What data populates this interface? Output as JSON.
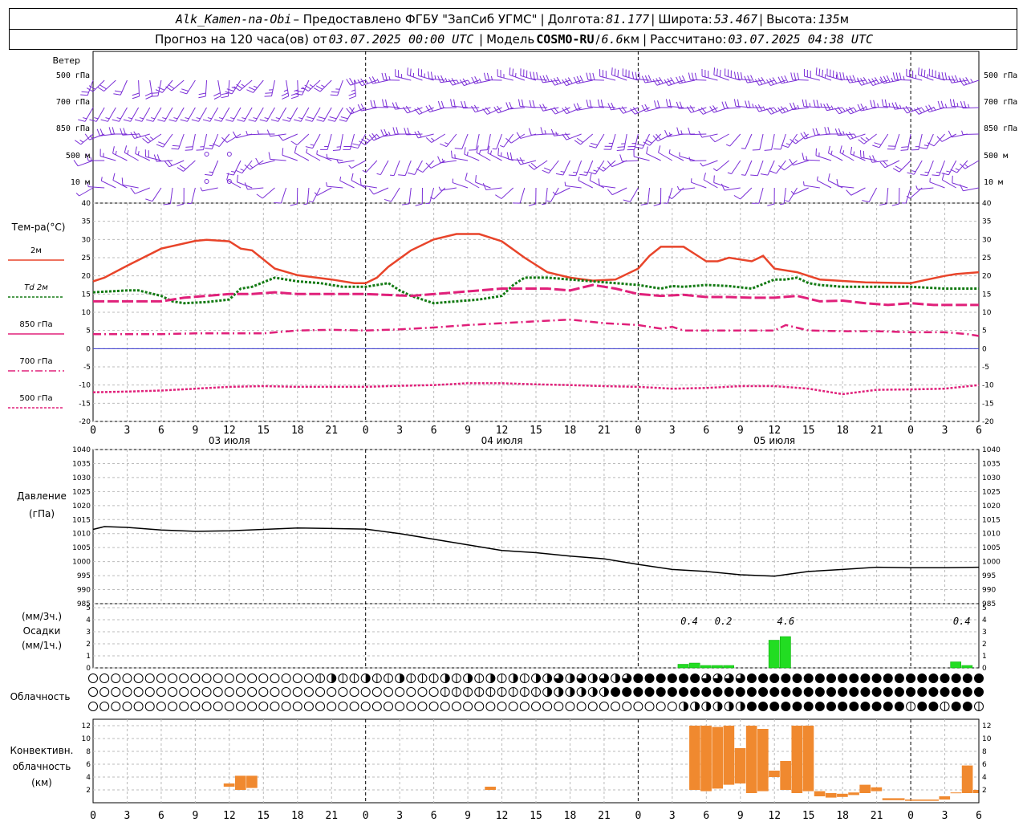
{
  "header": {
    "station": "Alk_Kamen-na-Obi",
    "provider": "– Предоставлено ФГБУ \"ЗапСиб УГМС\"",
    "lon_label": "Долгота:",
    "lon": "81.177",
    "lat_label": "Широта:",
    "lat": "53.467",
    "alt_label": "Высота:",
    "alt": "135",
    "alt_unit": "м",
    "forecast_label": "Прогноз на 120 часа(ов) от",
    "forecast_start": "03.07.2025 00:00 UTC",
    "model_label": "Модель",
    "model": "COSMO-RU",
    "resolution": "6.6",
    "resolution_unit": "км",
    "calc_label": "Рассчитано:",
    "calc_time": "03.07.2025 04:38 UTC"
  },
  "colors": {
    "t2m": "#e8442a",
    "td2m": "#137a13",
    "t850": "#e0207a",
    "t700": "#e0207a",
    "t500": "#e0207a",
    "wind": "#7a2ed6",
    "precip": "#22dd22",
    "conv": "#f0892f",
    "zero_line": "#3333cc"
  },
  "time_axis": {
    "hour_labels": [
      "0",
      "3",
      "6",
      "9",
      "12",
      "15",
      "18",
      "21",
      "0",
      "3",
      "6",
      "9",
      "12",
      "15",
      "18",
      "21",
      "0",
      "3",
      "6",
      "9",
      "12",
      "15",
      "18",
      "21",
      "0",
      "3",
      "6"
    ],
    "date_labels": [
      "03 июля",
      "04 июля",
      "05 июля"
    ]
  },
  "wind_panel": {
    "title": "Ветер",
    "levels": [
      "500 гПа",
      "700 гПа",
      "850 гПа",
      "500 м",
      "10 м"
    ]
  },
  "temp_panel": {
    "title": "Тем-ра(°C)",
    "legend": [
      "2м",
      "Td  2м",
      "850 гПа",
      "700 гПа",
      "500 гПа"
    ],
    "ticks": [
      "40",
      "35",
      "30",
      "25",
      "20",
      "15",
      "10",
      "5",
      "0",
      "-5",
      "-10",
      "-15",
      "-20"
    ]
  },
  "pressure_panel": {
    "title": "Давление",
    "unit": "(гПа)",
    "ticks": [
      "1040",
      "1035",
      "1030",
      "1025",
      "1020",
      "1015",
      "1010",
      "1005",
      "1000",
      "995",
      "990",
      "985"
    ]
  },
  "precip_panel": {
    "unit3h": "(мм/3ч.)",
    "title": "Осадки",
    "unit1h": "(мм/1ч.)",
    "ticks": [
      "5",
      "4",
      "3",
      "2",
      "1",
      "0"
    ],
    "totals": [
      "0.4",
      "0.2",
      "4.6",
      "0.4"
    ]
  },
  "cloud_panel": {
    "title": "Облачность"
  },
  "conv_panel": {
    "title": [
      "Конвективн.",
      "облачность",
      "(км)"
    ],
    "ticks": [
      "12",
      "10",
      "8",
      "6",
      "4",
      "2"
    ]
  },
  "chart_data": {
    "type": "line",
    "x_unit": "hours since 03.07.2025 00:00 UTC",
    "x_range": [
      0,
      78
    ],
    "temperature": {
      "ylim": [
        -20,
        40
      ],
      "series": [
        {
          "name": "2м",
          "x": [
            0,
            1,
            3,
            6,
            9,
            10,
            12,
            13,
            14,
            16,
            18,
            21,
            23,
            24,
            25,
            26,
            28,
            30,
            32,
            34,
            36,
            38,
            40,
            42,
            44,
            46,
            48,
            49,
            50,
            52,
            53,
            54,
            55,
            56,
            57,
            58,
            59,
            60,
            61,
            62,
            64,
            68,
            72,
            75,
            76,
            78
          ],
          "y": [
            18.5,
            19.5,
            22.8,
            27.5,
            29.6,
            29.9,
            29.5,
            27.5,
            27.0,
            22.0,
            20.2,
            19.0,
            18.0,
            18.0,
            19.5,
            22.5,
            27.0,
            30.0,
            31.5,
            31.5,
            29.5,
            25.0,
            21.0,
            19.5,
            18.7,
            19.0,
            22.0,
            25.5,
            28.0,
            28.0,
            26.0,
            24.0,
            24.0,
            25.0,
            24.5,
            24.0,
            25.5,
            22.0,
            21.5,
            21.0,
            19.0,
            18.2,
            18.0,
            20.0,
            20.5,
            21.0
          ]
        },
        {
          "name": "Td 2м",
          "x": [
            0,
            3,
            4,
            6,
            7,
            8,
            10,
            12,
            13,
            14,
            16,
            18,
            20,
            22,
            24,
            26,
            27,
            28,
            30,
            32,
            34,
            36,
            37,
            38,
            40,
            42,
            44,
            46,
            48,
            50,
            51,
            52,
            54,
            56,
            58,
            60,
            61,
            62,
            63,
            64,
            66,
            68,
            70,
            72,
            75,
            78
          ],
          "y": [
            15.5,
            16.0,
            16.0,
            14.5,
            13.0,
            12.5,
            12.8,
            13.5,
            16.5,
            17.0,
            19.5,
            18.5,
            18.0,
            17.0,
            17.0,
            18.0,
            16.0,
            14.5,
            12.5,
            13.0,
            13.5,
            14.5,
            17.5,
            19.5,
            19.5,
            19.0,
            18.5,
            18.0,
            17.5,
            16.5,
            17.2,
            17.0,
            17.5,
            17.2,
            16.5,
            19.0,
            19.0,
            19.5,
            18.0,
            17.5,
            17.0,
            17.0,
            17.0,
            17.0,
            16.5,
            16.5
          ]
        },
        {
          "name": "850 гПа",
          "x": [
            0,
            3,
            6,
            8,
            10,
            12,
            14,
            16,
            18,
            21,
            24,
            28,
            32,
            36,
            40,
            42,
            44,
            46,
            48,
            50,
            52,
            54,
            56,
            58,
            60,
            62,
            64,
            66,
            68,
            70,
            72,
            74,
            76,
            78
          ],
          "y": [
            13.0,
            13.0,
            13.0,
            14.0,
            14.5,
            15.0,
            15.0,
            15.5,
            15.0,
            15.0,
            15.0,
            14.5,
            15.5,
            16.5,
            16.5,
            16.0,
            17.5,
            16.5,
            15.0,
            14.5,
            14.8,
            14.2,
            14.2,
            14.0,
            14.0,
            14.5,
            13.0,
            13.2,
            12.5,
            12.0,
            12.5,
            12.0,
            12.0,
            12.0
          ]
        },
        {
          "name": "700 гПа",
          "x": [
            0,
            3,
            6,
            9,
            12,
            15,
            18,
            21,
            24,
            27,
            30,
            33,
            36,
            39,
            42,
            45,
            48,
            50,
            51,
            52,
            54,
            57,
            60,
            61,
            63,
            66,
            69,
            72,
            75,
            77,
            78
          ],
          "y": [
            4.0,
            4.0,
            4.0,
            4.2,
            4.2,
            4.2,
            5.0,
            5.2,
            5.0,
            5.3,
            5.8,
            6.5,
            7.0,
            7.5,
            8.0,
            7.0,
            6.5,
            5.5,
            6.0,
            5.0,
            5.0,
            5.0,
            5.0,
            6.5,
            5.0,
            4.8,
            4.8,
            4.5,
            4.5,
            4.0,
            3.5
          ]
        },
        {
          "name": "500 гПа",
          "x": [
            0,
            3,
            6,
            9,
            12,
            15,
            18,
            21,
            24,
            27,
            30,
            33,
            36,
            39,
            42,
            45,
            48,
            51,
            54,
            57,
            60,
            63,
            66,
            69,
            72,
            75,
            78
          ],
          "y": [
            -12.0,
            -11.8,
            -11.5,
            -11.0,
            -10.5,
            -10.3,
            -10.5,
            -10.5,
            -10.5,
            -10.2,
            -10.0,
            -9.5,
            -9.5,
            -9.8,
            -10.0,
            -10.3,
            -10.5,
            -11.0,
            -10.8,
            -10.3,
            -10.3,
            -11.0,
            -12.5,
            -11.3,
            -11.2,
            -11.0,
            -10.0
          ]
        }
      ]
    },
    "pressure": {
      "ylim": [
        985,
        1040
      ],
      "series": [
        {
          "name": "давление",
          "x": [
            0,
            1,
            3,
            6,
            9,
            12,
            15,
            18,
            21,
            24,
            27,
            30,
            33,
            36,
            39,
            42,
            45,
            48,
            51,
            54,
            57,
            60,
            63,
            66,
            69,
            72,
            75,
            78
          ],
          "y": [
            1011.5,
            1012.5,
            1012.2,
            1011.3,
            1010.8,
            1011.0,
            1011.5,
            1012.0,
            1011.8,
            1011.6,
            1010.0,
            1008.0,
            1006.0,
            1004.0,
            1003.2,
            1002.0,
            1001.0,
            999.0,
            997.2,
            996.5,
            995.3,
            994.8,
            996.5,
            997.2,
            998.0,
            997.8,
            997.8,
            998.0
          ]
        }
      ]
    },
    "precipitation": {
      "ylim": [
        0,
        5
      ],
      "x": [
        52,
        53,
        54,
        55,
        56,
        60,
        61,
        76,
        77
      ],
      "values": [
        0.3,
        0.4,
        0.2,
        0.2,
        0.2,
        2.3,
        2.6,
        0.5,
        0.2
      ],
      "totals_x": [
        52.5,
        55.5,
        61,
        76.5
      ]
    },
    "convective_cloud": {
      "ylim": [
        0,
        13
      ],
      "bars": [
        {
          "x": [
            11.5,
            12.5
          ],
          "base": 2.5,
          "top": 3.0
        },
        {
          "x": [
            12.5,
            13.5
          ],
          "base": 2.0,
          "top": 4.2
        },
        {
          "x": [
            13.5,
            14.5
          ],
          "base": 2.3,
          "top": 4.2
        },
        {
          "x": [
            34.5,
            35.5
          ],
          "base": 2.0,
          "top": 2.5
        },
        {
          "x": [
            52.5,
            53.5
          ],
          "base": 2.0,
          "top": 12.0
        },
        {
          "x": [
            53.5,
            54.5
          ],
          "base": 1.8,
          "top": 12.0
        },
        {
          "x": [
            54.5,
            55.5
          ],
          "base": 2.2,
          "top": 11.8
        },
        {
          "x": [
            55.5,
            56.5
          ],
          "base": 2.8,
          "top": 12.0
        },
        {
          "x": [
            56.5,
            57.5
          ],
          "base": 3.0,
          "top": 8.5
        },
        {
          "x": [
            57.5,
            58.5
          ],
          "base": 1.5,
          "top": 12.0
        },
        {
          "x": [
            58.5,
            59.5
          ],
          "base": 1.8,
          "top": 11.5
        },
        {
          "x": [
            59.5,
            60.5
          ],
          "base": 4.0,
          "top": 5.0
        },
        {
          "x": [
            60.5,
            61.5
          ],
          "base": 2.0,
          "top": 6.5
        },
        {
          "x": [
            61.5,
            62.5
          ],
          "base": 1.5,
          "top": 12.0
        },
        {
          "x": [
            62.5,
            63.5
          ],
          "base": 1.8,
          "top": 12.0
        },
        {
          "x": [
            63.5,
            64.5
          ],
          "base": 1.0,
          "top": 1.8
        },
        {
          "x": [
            64.5,
            65.5
          ],
          "base": 0.8,
          "top": 1.5
        },
        {
          "x": [
            65.5,
            66.5
          ],
          "base": 0.9,
          "top": 1.4
        },
        {
          "x": [
            66.5,
            67.5
          ],
          "base": 1.2,
          "top": 1.6
        },
        {
          "x": [
            67.5,
            68.5
          ],
          "base": 1.5,
          "top": 2.8
        },
        {
          "x": [
            68.5,
            69.5
          ],
          "base": 1.8,
          "top": 2.4
        },
        {
          "x": [
            69.5,
            71.5
          ],
          "base": 0.4,
          "top": 0.7
        },
        {
          "x": [
            71.5,
            74.5
          ],
          "base": 0.3,
          "top": 0.5
        },
        {
          "x": [
            74.5,
            75.5
          ],
          "base": 0.5,
          "top": 1.0
        },
        {
          "x": [
            75.5,
            76.5
          ],
          "base": 1.5,
          "top": 1.6
        },
        {
          "x": [
            76.5,
            77.5
          ],
          "base": 1.5,
          "top": 5.8
        },
        {
          "x": [
            77.5,
            78.0
          ],
          "base": 1.5,
          "top": 2.0
        }
      ]
    }
  }
}
